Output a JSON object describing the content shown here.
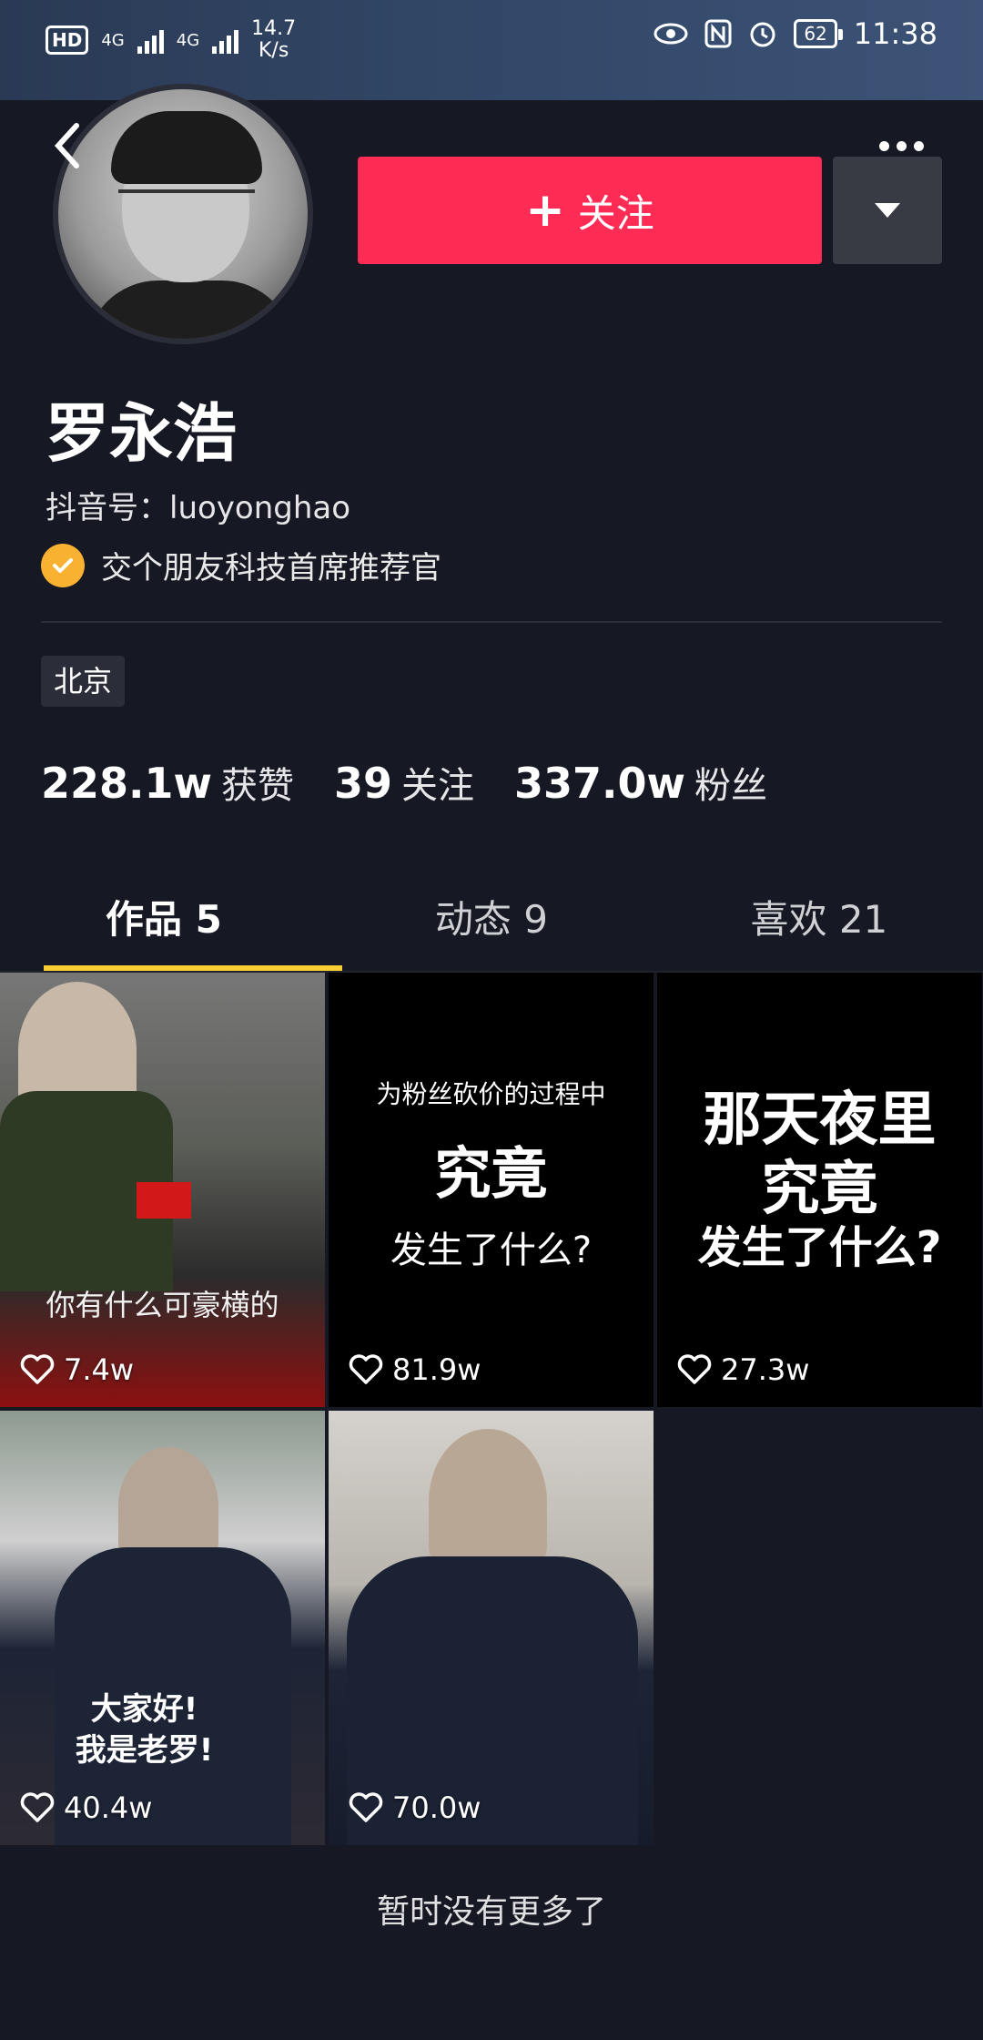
{
  "status_bar": {
    "hd_badge": "HD",
    "sim1_label": "4G",
    "sim2_label": "4G",
    "net_speed_value": "14.7",
    "net_speed_unit": "K/s",
    "battery": "62",
    "time": "11:38"
  },
  "profile": {
    "name": "罗永浩",
    "douyin_id": "抖音号：luoyonghao",
    "verify_text": "交个朋友科技首席推荐官",
    "location": "北京"
  },
  "actions": {
    "follow_label": "关注",
    "follow_plus": "+"
  },
  "stats": [
    {
      "num": "228.1w",
      "label": "获赞"
    },
    {
      "num": "39",
      "label": "关注"
    },
    {
      "num": "337.0w",
      "label": "粉丝"
    }
  ],
  "tabs": [
    {
      "label": "作品 5",
      "active": true
    },
    {
      "label": "动态 9",
      "active": false
    },
    {
      "label": "喜欢 21",
      "active": false
    }
  ],
  "videos": [
    {
      "likes": "7.4w",
      "caption": "你有什么可豪横的"
    },
    {
      "likes": "81.9w",
      "line1": "为粉丝砍价的过程中",
      "line2": "究竟",
      "line3": "发生了什么?"
    },
    {
      "likes": "27.3w",
      "line1": "那天夜里",
      "line2": "究竟",
      "line3": "发生了什么?"
    },
    {
      "likes": "40.4w",
      "line1": "大家好!",
      "line2": "我是老罗!"
    },
    {
      "likes": "70.0w"
    }
  ],
  "footer_text": "暂时没有更多了",
  "colors": {
    "background": "#161823",
    "follow_button": "#fe2c55",
    "tab_underline": "#facd32",
    "verify_badge": "#f9b131"
  }
}
